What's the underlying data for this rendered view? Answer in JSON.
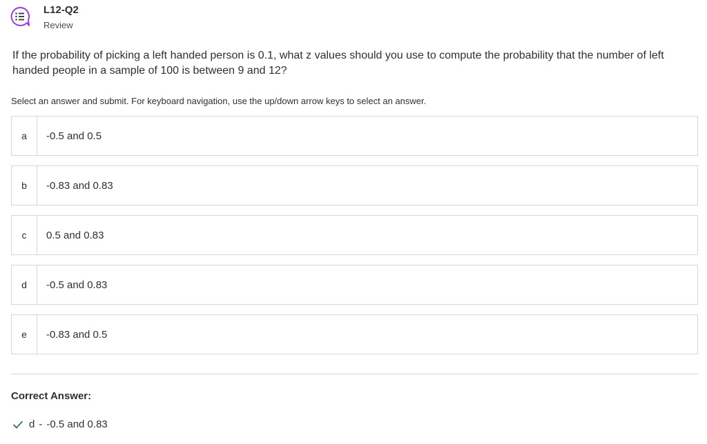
{
  "header": {
    "icon": "quiz-icon",
    "title": "L12-Q2",
    "status": "Review"
  },
  "question": "If the probability of picking a left handed person is 0.1, what z values should you use to compute the probability that the number of left handed people in a sample of 100 is between 9 and 12?",
  "instructions": "Select an answer and submit. For keyboard navigation, use the up/down arrow keys to select an answer.",
  "options": [
    {
      "letter": "a",
      "text": "-0.5 and 0.5"
    },
    {
      "letter": "b",
      "text": "-0.83 and 0.83"
    },
    {
      "letter": "c",
      "text": "0.5 and 0.83"
    },
    {
      "letter": "d",
      "text": "-0.5 and 0.83"
    },
    {
      "letter": "e",
      "text": "-0.83 and 0.5"
    }
  ],
  "result": {
    "heading": "Correct Answer:",
    "icon": "check-icon",
    "letter": "d",
    "separator": "-",
    "text": "-0.5 and 0.83"
  },
  "colors": {
    "accent": "#a435f0",
    "check": "#1e6055",
    "border": "#d1d7dc"
  }
}
